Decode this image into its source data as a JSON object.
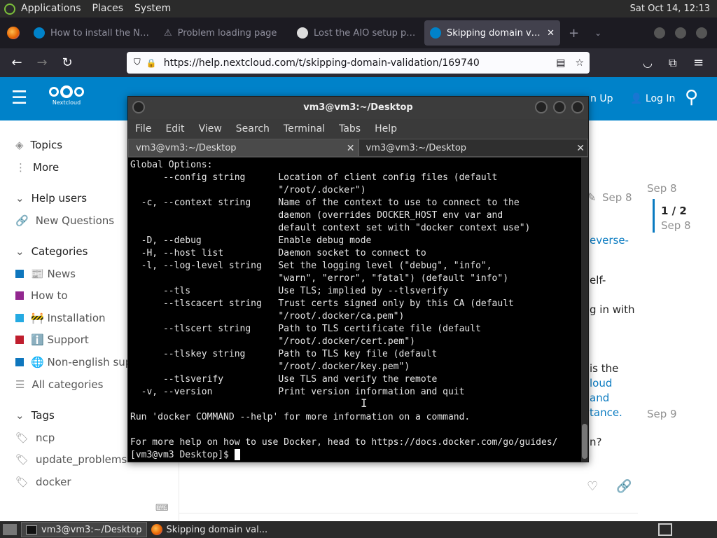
{
  "top_panel": {
    "menus": [
      "Applications",
      "Places",
      "System"
    ],
    "clock": "Sat Oct 14, 12:13"
  },
  "browser": {
    "tabs": [
      {
        "title": "How to install the Ne…",
        "active": false
      },
      {
        "title": "Problem loading page",
        "active": false
      },
      {
        "title": "Lost the AIO setup pa…",
        "active": false
      },
      {
        "title": "Skipping domain valida…",
        "active": true
      }
    ],
    "url": "https://help.nextcloud.com/t/skipping-domain-validation/169740"
  },
  "nextcloud": {
    "logo_text": "Nextcloud",
    "signup": "n Up",
    "login": "Log In",
    "sidebar": {
      "topics": "Topics",
      "more": "More",
      "help_users": "Help users",
      "new_questions": "New Questions",
      "categories_heading": "Categories",
      "categories": [
        {
          "label": "📰 News",
          "color": "#0e76bd"
        },
        {
          "label": "How to",
          "color": "#92278f"
        },
        {
          "label": "🚧 Installation",
          "color": "#25aae2"
        },
        {
          "label": "ℹ️ Support",
          "color": "#bf1e2e"
        },
        {
          "label": "🌐 Non-english supp",
          "color": "#0e76bd"
        }
      ],
      "all_categories": "All categories",
      "tags_heading": "Tags",
      "tags": [
        "ncp",
        "update_problems",
        "docker"
      ]
    },
    "main": {
      "post_date": "Sep 8",
      "timeline_top": "Sep 8",
      "timeline_pos": "1 / 2",
      "timeline_date": "Sep 8",
      "timeline_bottom": "Sep 9",
      "fragments": [
        "everse-",
        "elf-",
        "g in with",
        "is the",
        "loud",
        "and",
        "tance.",
        "n?"
      ]
    }
  },
  "terminal": {
    "title": "vm3@vm3:~/Desktop",
    "menu": [
      "File",
      "Edit",
      "View",
      "Search",
      "Terminal",
      "Tabs",
      "Help"
    ],
    "tabs": [
      "vm3@vm3:~/Desktop",
      "vm3@vm3:~/Desktop"
    ],
    "lines": [
      "Global Options:",
      "      --config string      Location of client config files (default",
      "                           \"/root/.docker\")",
      "  -c, --context string     Name of the context to use to connect to the",
      "                           daemon (overrides DOCKER_HOST env var and",
      "                           default context set with \"docker context use\")",
      "  -D, --debug              Enable debug mode",
      "  -H, --host list          Daemon socket to connect to",
      "  -l, --log-level string   Set the logging level (\"debug\", \"info\",",
      "                           \"warn\", \"error\", \"fatal\") (default \"info\")",
      "      --tls                Use TLS; implied by --tlsverify",
      "      --tlscacert string   Trust certs signed only by this CA (default",
      "                           \"/root/.docker/ca.pem\")",
      "      --tlscert string     Path to TLS certificate file (default",
      "                           \"/root/.docker/cert.pem\")",
      "      --tlskey string      Path to TLS key file (default",
      "                           \"/root/.docker/key.pem\")",
      "      --tlsverify          Use TLS and verify the remote",
      "  -v, --version            Print version information and quit",
      "",
      "Run 'docker COMMAND --help' for more information on a command.",
      "",
      "For more help on how to use Docker, head to https://docs.docker.com/go/guides/"
    ],
    "prompt": "[vm3@vm3 Desktop]$ "
  },
  "taskbar": {
    "items": [
      "vm3@vm3:~/Desktop",
      "Skipping domain val..."
    ]
  }
}
